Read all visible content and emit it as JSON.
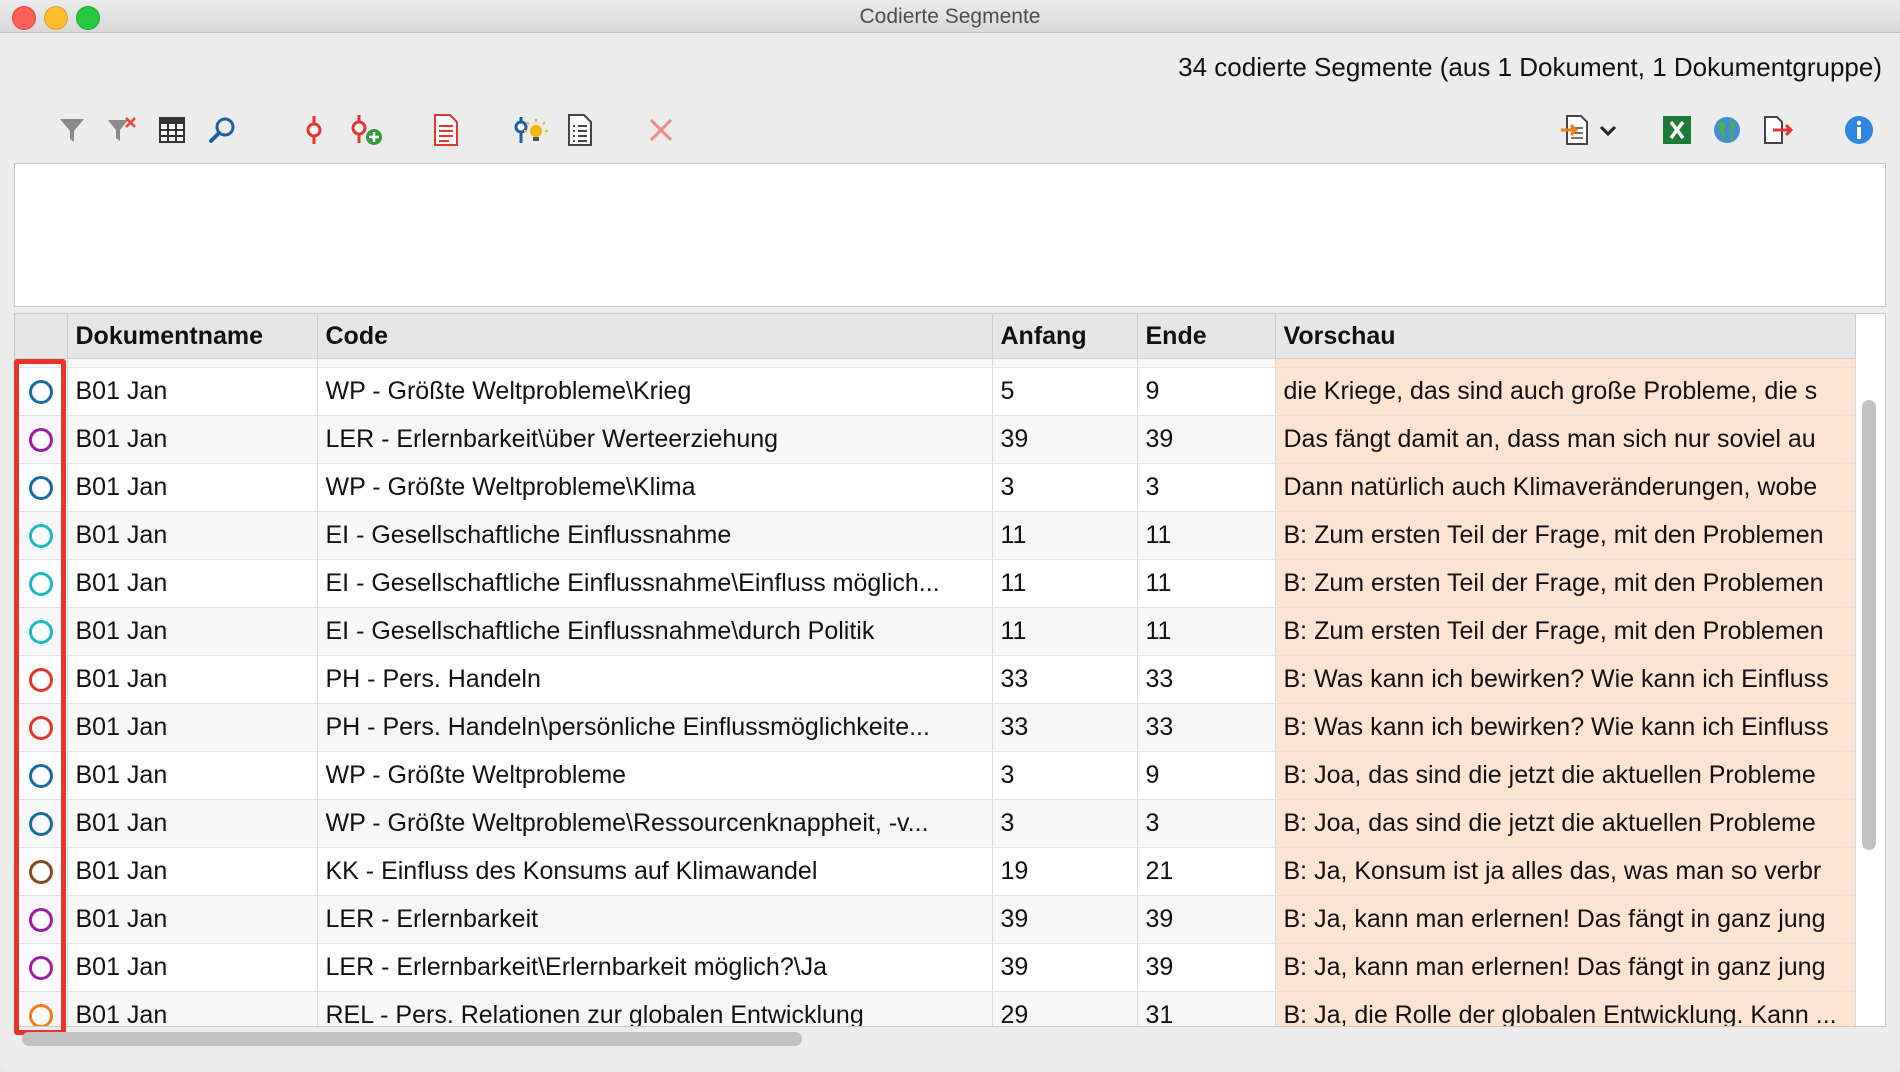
{
  "window": {
    "title": "Codierte Segmente"
  },
  "summary": "34 codierte Segmente (aus 1 Dokument, 1 Dokumentgruppe)",
  "toolbar": {
    "left": [
      {
        "name": "filter-icon",
        "label": "filter"
      },
      {
        "name": "remove-filter-icon",
        "label": "remove-filter"
      },
      {
        "name": "columns-icon",
        "label": "columns"
      },
      {
        "name": "search-icon",
        "label": "search"
      },
      {
        "name": "code-icon",
        "label": "code"
      },
      {
        "name": "add-code-icon",
        "label": "add-code"
      },
      {
        "name": "document-icon",
        "label": "document"
      },
      {
        "name": "smart-coding-icon",
        "label": "smart-coding"
      },
      {
        "name": "list-icon",
        "label": "list"
      },
      {
        "name": "delete-icon",
        "label": "delete"
      }
    ],
    "right": [
      {
        "name": "export-dropdown-icon",
        "label": "export"
      },
      {
        "name": "excel-icon",
        "label": "excel"
      },
      {
        "name": "web-icon",
        "label": "web"
      },
      {
        "name": "open-export-icon",
        "label": "open-export"
      },
      {
        "name": "info-icon",
        "label": "info"
      }
    ]
  },
  "table": {
    "columns": [
      "",
      "Dokumentname",
      "Code",
      "Anfang",
      "Ende",
      "Vorschau"
    ],
    "rows": [
      {
        "color": "#1b6aa5",
        "doc": "B01 Jan",
        "code": "WP - Größte Weltprobleme\\Krieg",
        "start": "5",
        "end": "9",
        "preview": "die Kriege, das sind auch große Probleme, die s"
      },
      {
        "color": "#9b1fa8",
        "doc": "B01 Jan",
        "code": "LER - Erlernbarkeit\\über Werteerziehung",
        "start": "39",
        "end": "39",
        "preview": "Das fängt damit an, dass man sich nur soviel au"
      },
      {
        "color": "#1b6aa5",
        "doc": "B01 Jan",
        "code": "WP - Größte Weltprobleme\\Klima",
        "start": "3",
        "end": "3",
        "preview": "Dann natürlich auch Klimaveränderungen, wobe"
      },
      {
        "color": "#1fb9c9",
        "doc": "B01 Jan",
        "code": "EI - Gesellschaftliche Einflussnahme",
        "start": "11",
        "end": "11",
        "preview": "B: Zum ersten Teil der Frage, mit den Problemen"
      },
      {
        "color": "#1fb9c9",
        "doc": "B01 Jan",
        "code": "EI - Gesellschaftliche Einflussnahme\\Einfluss möglich...",
        "start": "11",
        "end": "11",
        "preview": "B: Zum ersten Teil der Frage, mit den Problemen"
      },
      {
        "color": "#1fb9c9",
        "doc": "B01 Jan",
        "code": "EI - Gesellschaftliche Einflussnahme\\durch Politik",
        "start": "11",
        "end": "11",
        "preview": "B: Zum ersten Teil der Frage, mit den Problemen"
      },
      {
        "color": "#e8352a",
        "doc": "B01 Jan",
        "code": "PH - Pers. Handeln",
        "start": "33",
        "end": "33",
        "preview": "B: Was kann ich bewirken? Wie kann ich Einfluss"
      },
      {
        "color": "#e8352a",
        "doc": "B01 Jan",
        "code": "PH - Pers. Handeln\\persönliche Einflussmöglichkeite...",
        "start": "33",
        "end": "33",
        "preview": "B: Was kann ich bewirken? Wie kann ich Einfluss"
      },
      {
        "color": "#1b6aa5",
        "doc": "B01 Jan",
        "code": "WP - Größte Weltprobleme",
        "start": "3",
        "end": "9",
        "preview": "B: Joa, das sind die jetzt die aktuellen Probleme"
      },
      {
        "color": "#1b6aa5",
        "doc": "B01 Jan",
        "code": "WP - Größte Weltprobleme\\Ressourcenknappheit, -v...",
        "start": "3",
        "end": "3",
        "preview": "B: Joa, das sind die jetzt die aktuellen Probleme"
      },
      {
        "color": "#8a4a1f",
        "doc": "B01 Jan",
        "code": "KK - Einfluss des Konsums auf Klimawandel",
        "start": "19",
        "end": "21",
        "preview": "B: Ja, Konsum ist ja alles das, was man so verbr"
      },
      {
        "color": "#9b1fa8",
        "doc": "B01 Jan",
        "code": "LER - Erlernbarkeit",
        "start": "39",
        "end": "39",
        "preview": "B: Ja, kann man erlernen! Das fängt in ganz jung"
      },
      {
        "color": "#9b1fa8",
        "doc": "B01 Jan",
        "code": "LER - Erlernbarkeit\\Erlernbarkeit möglich?\\Ja",
        "start": "39",
        "end": "39",
        "preview": "B: Ja, kann man erlernen! Das fängt in ganz jung"
      },
      {
        "color": "#f07d1a",
        "doc": "B01 Jan",
        "code": "REL - Pers. Relationen zur globalen Entwicklung",
        "start": "29",
        "end": "31",
        "preview": "B: Ja, die Rolle der globalen Entwicklung. Kann ..."
      }
    ]
  }
}
